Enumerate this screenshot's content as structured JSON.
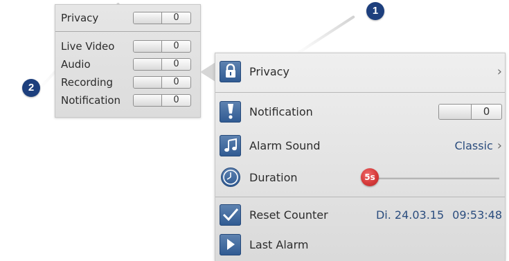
{
  "callouts": {
    "one": "1",
    "two": "2"
  },
  "small_panel": {
    "privacy": {
      "label": "Privacy",
      "state": "0"
    },
    "items": [
      {
        "label": "Live Video",
        "state": "0"
      },
      {
        "label": "Audio",
        "state": "0"
      },
      {
        "label": "Recording",
        "state": "0"
      },
      {
        "label": "Notification",
        "state": "0"
      }
    ]
  },
  "main_panel": {
    "privacy_label": "Privacy",
    "notification": {
      "label": "Notification",
      "state": "0"
    },
    "alarm_sound": {
      "label": "Alarm Sound",
      "value": "Classic"
    },
    "duration": {
      "label": "Duration",
      "value": "5s"
    },
    "reset_counter": {
      "label": "Reset Counter",
      "date": "Di. 24.03.15",
      "time": "09:53:48"
    },
    "last_alarm": {
      "label": "Last Alarm"
    },
    "chevron": "›"
  },
  "icons": {
    "privacy": "lock-icon",
    "notification": "exclamation-icon",
    "alarm_sound": "music-note-icon",
    "duration": "clock-icon",
    "reset_counter": "checkmark-icon",
    "last_alarm": "play-icon"
  },
  "colors": {
    "accent_blue": "#2b4d7e",
    "badge_blue": "#1d3f7d",
    "slider_thumb": "#d63a3a"
  }
}
